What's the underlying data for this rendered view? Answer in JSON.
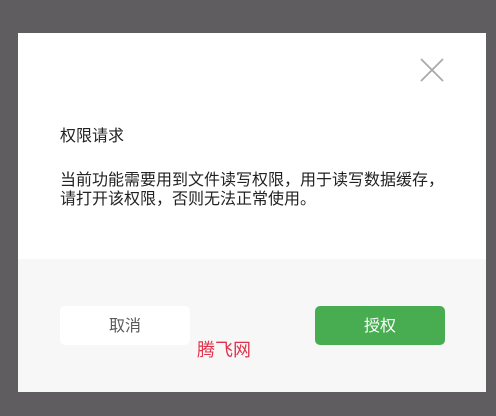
{
  "dialog": {
    "title": "权限请求",
    "message": "当前功能需要用到文件读写权限，用于读写数据缓存，请打开该权限，否则无法正常使用。",
    "close_icon": "close-icon",
    "buttons": {
      "cancel_label": "取消",
      "grant_label": "授权"
    }
  },
  "watermark": {
    "text": "腾飞网"
  },
  "colors": {
    "backdrop": "#5f5d60",
    "dialog_top": "#ffffff",
    "dialog_bottom": "#f7f7f7",
    "grant_button": "#47ad50",
    "watermark": "#e0324a"
  }
}
